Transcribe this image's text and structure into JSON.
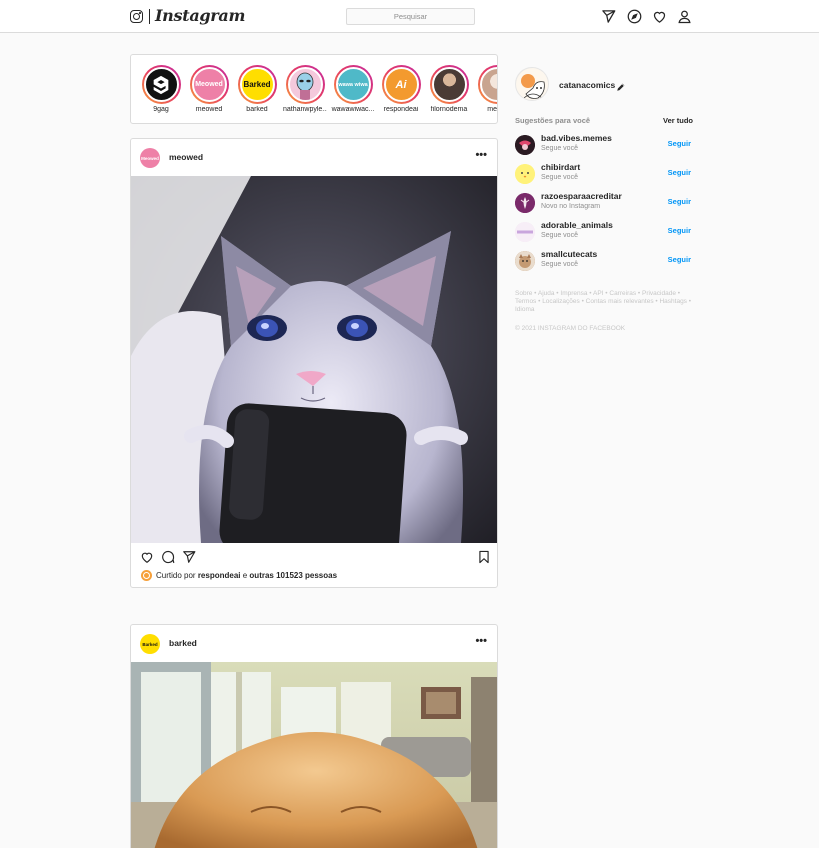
{
  "header": {
    "logo_text": "Instagram",
    "search_placeholder": "Pesquisar",
    "icons": [
      "direct-icon",
      "explore-icon",
      "heart-icon",
      "profile-icon"
    ]
  },
  "stories": [
    {
      "name": "9gag",
      "avatar_text": "",
      "color": "#111111"
    },
    {
      "name": "meowed",
      "avatar_text": "Meowed",
      "color": "#ee80a7"
    },
    {
      "name": "barked",
      "avatar_text": "Barked",
      "color": "#ffde00"
    },
    {
      "name": "nathanwpyle...",
      "avatar_text": "",
      "color": "#f4c9dc"
    },
    {
      "name": "wawawiwac...",
      "avatar_text": "wawa wiwa",
      "color": "#4fb9c8"
    },
    {
      "name": "respondeai",
      "avatar_text": "Ai",
      "color": "#f39a2e"
    },
    {
      "name": "filornodema",
      "avatar_text": "",
      "color": "#4a3b35"
    },
    {
      "name": "meme",
      "avatar_text": "",
      "color": "#e6d4c8"
    }
  ],
  "posts": [
    {
      "username": "meowed",
      "avatar_text": "Meowed",
      "avatar_color": "#ee80a7",
      "more_label": "•••",
      "liked_prefix": "Curtido por",
      "liked_user": "respondeai",
      "liked_joiner": "e",
      "liked_rest": "outras 101523 pessoas"
    },
    {
      "username": "barked",
      "avatar_text": "Barked",
      "avatar_color": "#ffde00",
      "more_label": "•••"
    }
  ],
  "sidebar": {
    "username": "catanacomics",
    "suggestions_title": "Sugestões para você",
    "see_all": "Ver tudo",
    "follow_label": "Seguir",
    "suggestions": [
      {
        "name": "bad.vibes.memes",
        "sub": "Segue você",
        "color": "#2a1a22"
      },
      {
        "name": "chibirdart",
        "sub": "Segue você",
        "color": "#fff27a"
      },
      {
        "name": "razoesparaacreditar",
        "sub": "Novo no Instagram",
        "color": "#7a2a6a"
      },
      {
        "name": "adorable_animals",
        "sub": "Segue você",
        "color": "#f2e6f2"
      },
      {
        "name": "smallcutecats",
        "sub": "Segue você",
        "color": "#c49a73"
      }
    ],
    "footer_links": "Sobre • Ajuda • Imprensa • API • Carreiras • Privacidade • Termos • Localizações • Contas mais relevantes • Hashtags • Idioma",
    "copyright": "© 2021 INSTAGRAM DO FACEBOOK"
  }
}
